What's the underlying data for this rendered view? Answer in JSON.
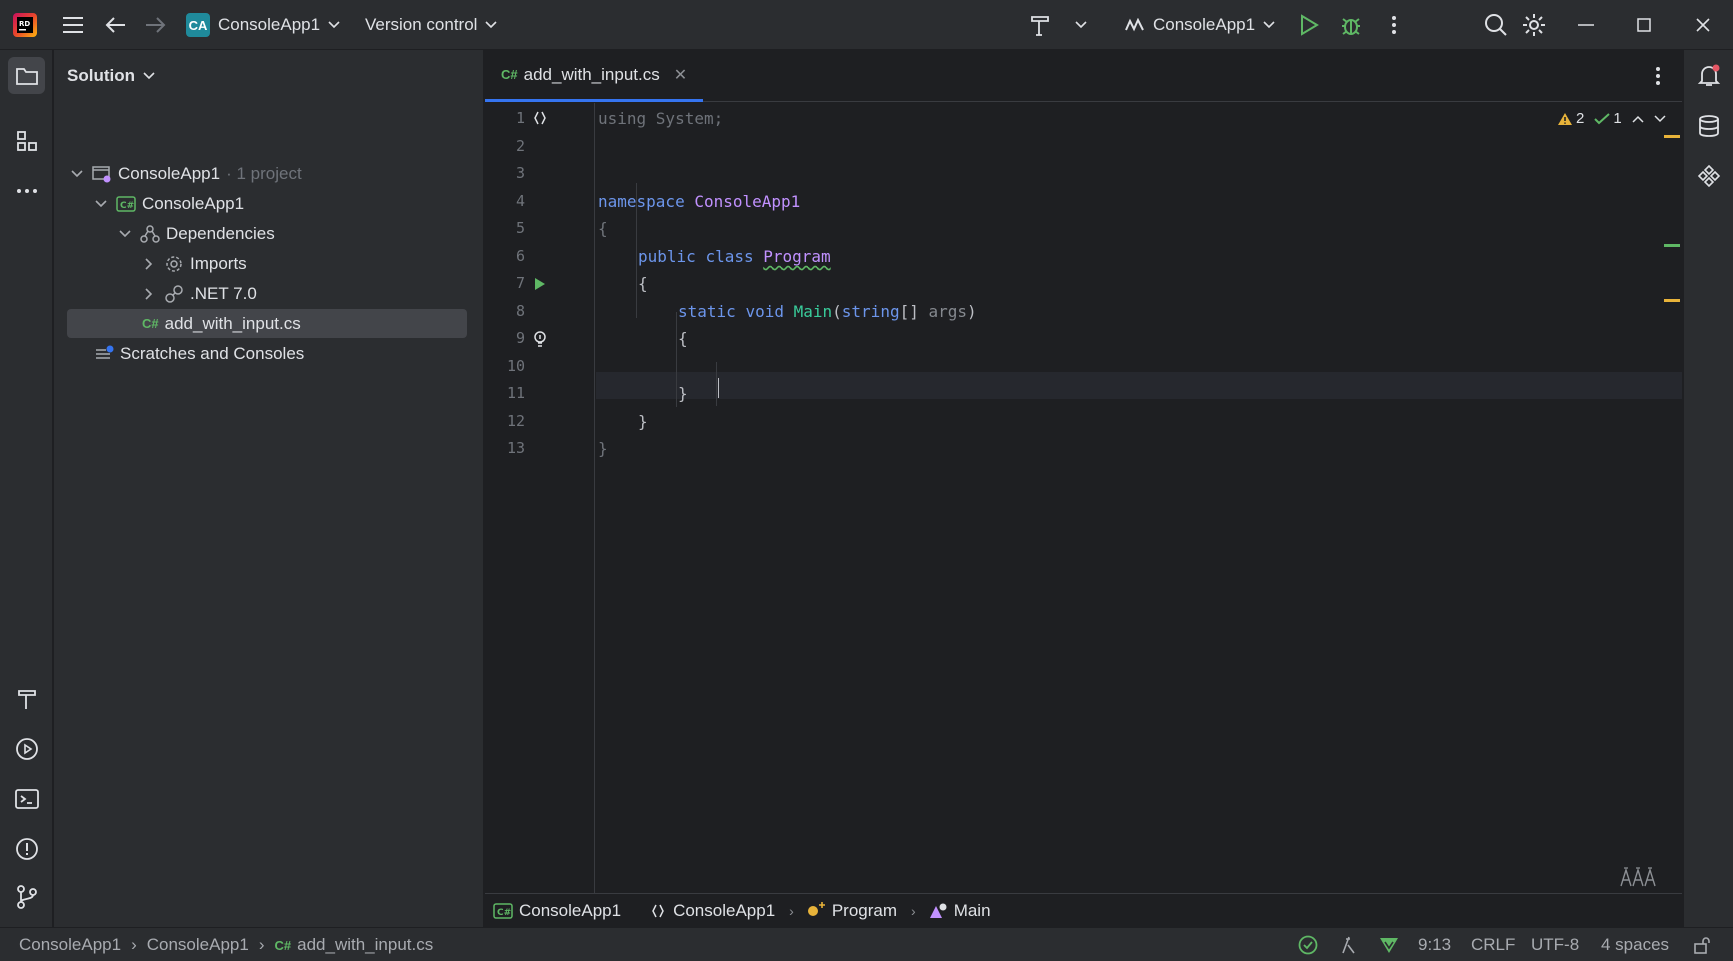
{
  "titlebar": {
    "project_initials": "CA",
    "project_name": "ConsoleApp1",
    "vcs_label": "Version control",
    "run_config": "ConsoleApp1"
  },
  "solution": {
    "title": "Solution",
    "root": {
      "name": "ConsoleApp1",
      "suffix": "· 1 project"
    },
    "project": "ConsoleApp1",
    "dependencies": "Dependencies",
    "imports": "Imports",
    "framework": ".NET 7.0",
    "file_tag": "C#",
    "file": "add_with_input.cs",
    "scratches": "Scratches and Consoles"
  },
  "editor": {
    "tab_tag": "C#",
    "tab_label": "add_with_input.cs",
    "warnings": "2",
    "checks": "1",
    "line_numbers": [
      "1",
      "2",
      "3",
      "4",
      "5",
      "6",
      "7",
      "8",
      "9",
      "10",
      "11",
      "12",
      "13"
    ],
    "code": {
      "l1": "using System;",
      "l3_kw": "namespace",
      "l3_name": "ConsoleApp1",
      "l4": "{",
      "l5_kw1": "public",
      "l5_kw2": "class",
      "l5_name": "Program",
      "l6": "{",
      "l7_kw1": "static",
      "l7_kw2": "void",
      "l7_fn": "Main",
      "l7_open": "(",
      "l7_type": "string",
      "l7_arr": "[] ",
      "l7_prm": "args",
      "l7_close": ")",
      "l8": "{",
      "l10": "}",
      "l11": "}",
      "l12": "}"
    }
  },
  "breadcrumbs": {
    "tag": "C#",
    "project": "ConsoleApp1",
    "namespace": "ConsoleApp1",
    "class": "Program",
    "method": "Main"
  },
  "statusbar": {
    "path_project": "ConsoleApp1",
    "path_folder": "ConsoleApp1",
    "path_tag": "C#",
    "path_file": "add_with_input.cs",
    "position": "9:13",
    "line_ending": "CRLF",
    "encoding": "UTF-8",
    "indent": "4 spaces"
  },
  "colors": {
    "accent": "#3574f0",
    "run_green": "#5fb865",
    "warning": "#e8b33a",
    "project_badge": "#1f8a9b"
  }
}
